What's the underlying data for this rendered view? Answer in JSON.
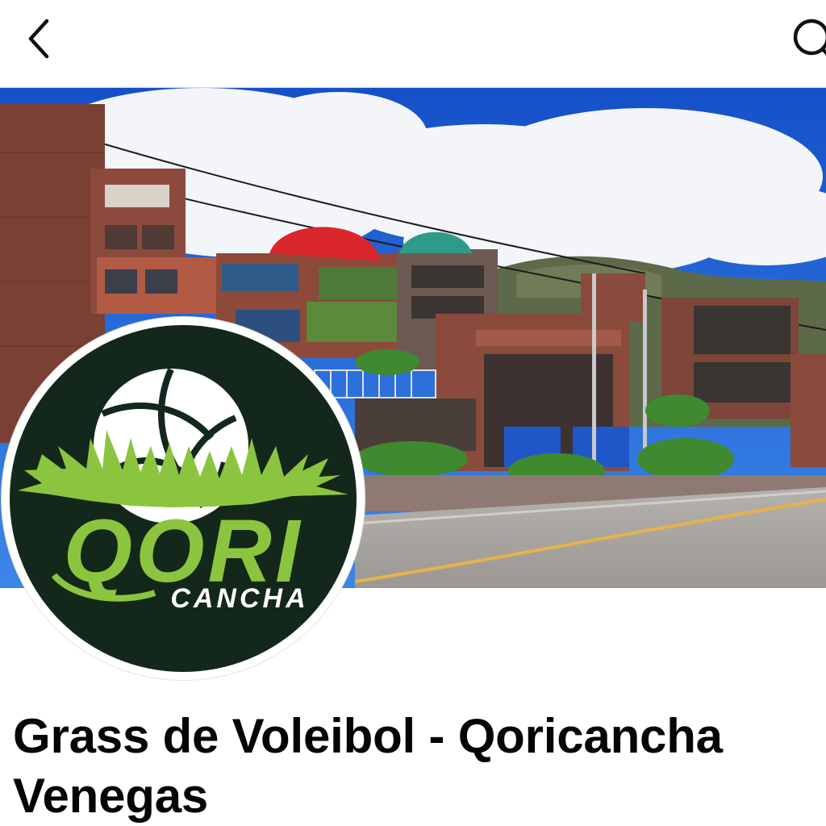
{
  "header": {
    "back_icon": "chevron-left-icon",
    "search_icon": "search-icon"
  },
  "cover_photo": {
    "description_icon": "cover-photo",
    "colors": {
      "sky": "#1d63d6",
      "cloud": "#f4f6f9",
      "brick": "#8a4a3a",
      "red_dome": "#d8242a",
      "teal_dome": "#2f9a8a",
      "road": "#a9a6a2",
      "road_line": "#e7b24a",
      "hill": "#5c6a4a"
    }
  },
  "profile": {
    "logo": {
      "brand_primary": "QORI",
      "brand_secondary": "CANCHA",
      "colors": {
        "background": "#13281b",
        "grass": "#8bc53f",
        "ball": "#ffffff",
        "text_secondary": "#ffffff"
      }
    },
    "page_name": "Grass de Voleibol - Qoricancha Venegas"
  }
}
